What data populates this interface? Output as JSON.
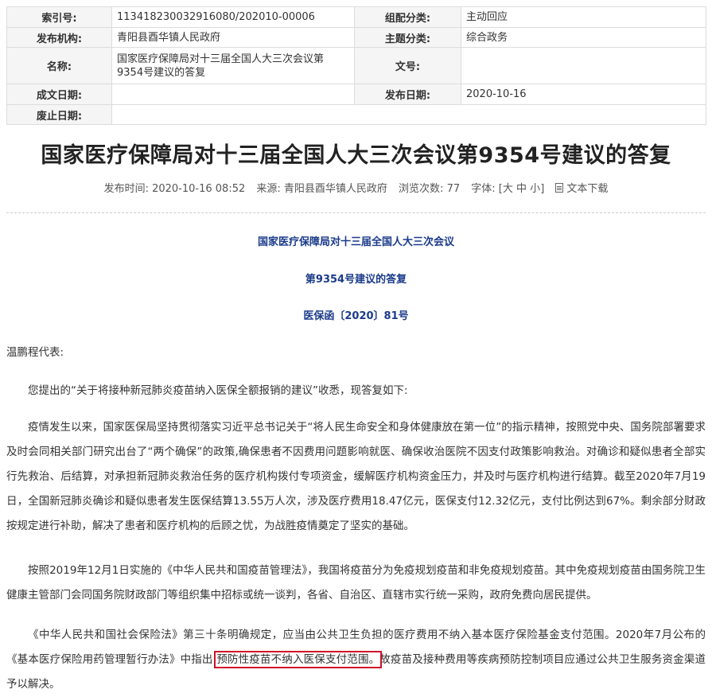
{
  "meta_table": {
    "index_label": "索引号:",
    "index_value": "11341823003291608​0/202010-00006",
    "category_label": "组配分类:",
    "category_value": "主动回应",
    "publisher_label": "发布机构:",
    "publisher_value": "青阳县酉华镇人民政府",
    "topic_label": "主题分类:",
    "topic_value": "综合政务",
    "name_label": "名称:",
    "name_value": "国家医疗保障局对十三届全国人大三次会议第9354号建议的答复",
    "docno_label": "文号:",
    "docno_value": "",
    "written_label": "成文日期:",
    "written_value": "",
    "pubdate_label": "发布日期:",
    "pubdate_value": "2020-10-16",
    "expire_label": "废止日期:",
    "expire_value": ""
  },
  "article": {
    "title": "国家医疗保障局对十三届全国人大三次会议第9354号建议的答复",
    "info": {
      "time": "发布时间: 2020-10-16 08:52",
      "source": "来源: 青阳县酉华镇人民政府",
      "views_label": "浏览次数:",
      "views": "77",
      "font_label": "字体: [",
      "font_large": "大",
      "font_medium": "中",
      "font_small": "小",
      "font_close": "]",
      "download": "文本下载"
    },
    "heading_lines": [
      "国家医疗保障局对十三届全国人大三次会议",
      "第9354号建议的答复",
      "医保函〔2020〕81号"
    ],
    "salutation": "温鹏程代表:",
    "paragraphs": [
      "您提出的“关于将接种新冠肺炎疫苗纳入医保全额报销的建议”收悉，现答复如下:",
      "疫情发生以来，国家医保局坚持贯彻落实习近平总书记关于“将人民生命安全和身体健康放在第一位”的指示精神，按照党中央、国务院部署要求及时会同相关部门研究出台了“两个确保”的政策,确保患者不因费用问题影响就医、确保收治医院不因支付政策影响救治。对确诊和疑似患者全部实行先救治、后结算，对承担新冠肺炎救治任务的医疗机构拨付专项资金，缓解医疗机构资金压力，并及时与医疗机构进行结算。截至2020年7月19日，全国新冠肺炎确诊和疑似患者发生医保结算13.55万人次，涉及医疗费用18.47亿元，医保支付12.32亿元，支付比例达到67%。剩余部分财政按规定进行补助，解决了患者和医疗机构的后顾之忧，为战胜疫情奠定了坚实的基础。",
      "按照2019年12月1日实施的《中华人民共和国疫苗管理法》，我国将疫苗分为免疫规划疫苗和非免疫规划疫苗。其中免疫规划疫苗由国务院卫生健康主管部门会同国务院财政部门等组织集中招标或统一谈判，各省、自治区、直辖市实行统一采购，政府免费向居民提供。"
    ],
    "last_paragraph": {
      "before": "《中华人民共和国社会保险法》第三十条明确规定，应当由公共卫生负担的医疗费用不纳入基本医疗保险基金支付范围。2020年7月公布的《基本医疗保险用药管理暂行办法》中指出:",
      "highlight": "预防性疫苗不纳入医保支付范围。",
      "after": "故疫苗及接种费用等疾病预防控制项目应通过公共卫生服务资金渠道予以解决。"
    }
  },
  "colors": {
    "heading_blue": "#1a3a8a",
    "highlight_red": "#d0102a",
    "label_bg": "#f5f5f5"
  }
}
